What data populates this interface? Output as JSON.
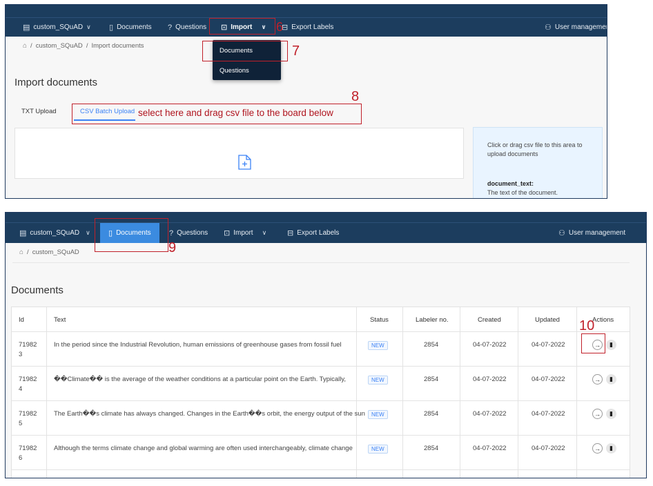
{
  "top": {
    "nav": {
      "project": "custom_SQuAD",
      "documents": "Documents",
      "questions": "Questions",
      "import": "Import",
      "export": "Export Labels",
      "user_mgmt": "User management"
    },
    "breadcrumb": {
      "project": "custom_SQuAD",
      "sep": "/",
      "current": "Import documents"
    },
    "dropdown": [
      "Documents",
      "Questions"
    ],
    "page_title": "Import documents",
    "tabs": [
      "TXT Upload",
      "CSV Batch Upload"
    ],
    "info": {
      "hint": "Click or drag csv file to this area to upload documents",
      "field": "document_text:",
      "field_desc": "The text of the document."
    },
    "annotations": {
      "n6": "6",
      "n7": "7",
      "n8": "8",
      "tab_note": "select here and drag csv file to the board below"
    }
  },
  "bottom": {
    "nav": {
      "project": "custom_SQuAD",
      "documents": "Documents",
      "questions": "Questions",
      "import": "Import",
      "export": "Export Labels",
      "user_mgmt": "User management"
    },
    "breadcrumb": {
      "project": "custom_SQuAD",
      "sep": "/"
    },
    "page_title": "Documents",
    "annotations": {
      "n9": "9",
      "n10": "10"
    },
    "table": {
      "headers": [
        "Id",
        "Text",
        "Status",
        "Labeler no.",
        "Created",
        "Updated",
        "Actions"
      ],
      "rows": [
        {
          "id1": "71982",
          "id2": "3",
          "text": "In the period since the Industrial Revolution, human emissions of greenhouse gases from fossil fuel",
          "status": "NEW",
          "labeler": "2854",
          "created": "04-07-2022",
          "updated": "04-07-2022"
        },
        {
          "id1": "71982",
          "id2": "4",
          "text": "��Climate�� is the average of the weather conditions at a particular point on the Earth. Typically,",
          "status": "NEW",
          "labeler": "2854",
          "created": "04-07-2022",
          "updated": "04-07-2022"
        },
        {
          "id1": "71982",
          "id2": "5",
          "text": "The Earth��s climate has always changed. Changes in the Earth��s orbit, the energy output of the sun",
          "status": "NEW",
          "labeler": "2854",
          "created": "04-07-2022",
          "updated": "04-07-2022"
        },
        {
          "id1": "71982",
          "id2": "6",
          "text": "Although the terms climate change and global warming are often used interchangeably, climate change",
          "status": "NEW",
          "labeler": "2854",
          "created": "04-07-2022",
          "updated": "04-07-2022"
        }
      ]
    }
  }
}
